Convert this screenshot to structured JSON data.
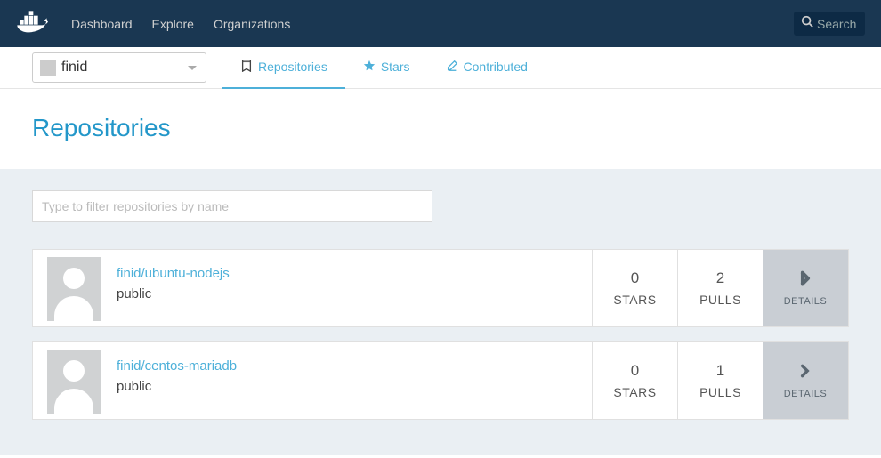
{
  "nav": {
    "dashboard": "Dashboard",
    "explore": "Explore",
    "organizations": "Organizations"
  },
  "search": {
    "placeholder": "Search"
  },
  "user": {
    "name": "finid"
  },
  "tabs": {
    "repos": "Repositories",
    "stars": "Stars",
    "contributed": "Contributed"
  },
  "page": {
    "title": "Repositories"
  },
  "filter": {
    "placeholder": "Type to filter repositories by name"
  },
  "labels": {
    "stars": "STARS",
    "pulls": "PULLS",
    "details": "DETAILS"
  },
  "repos": [
    {
      "name": "finid/ubuntu-nodejs",
      "visibility": "public",
      "stars": "0",
      "pulls": "2"
    },
    {
      "name": "finid/centos-mariadb",
      "visibility": "public",
      "stars": "0",
      "pulls": "1"
    }
  ]
}
